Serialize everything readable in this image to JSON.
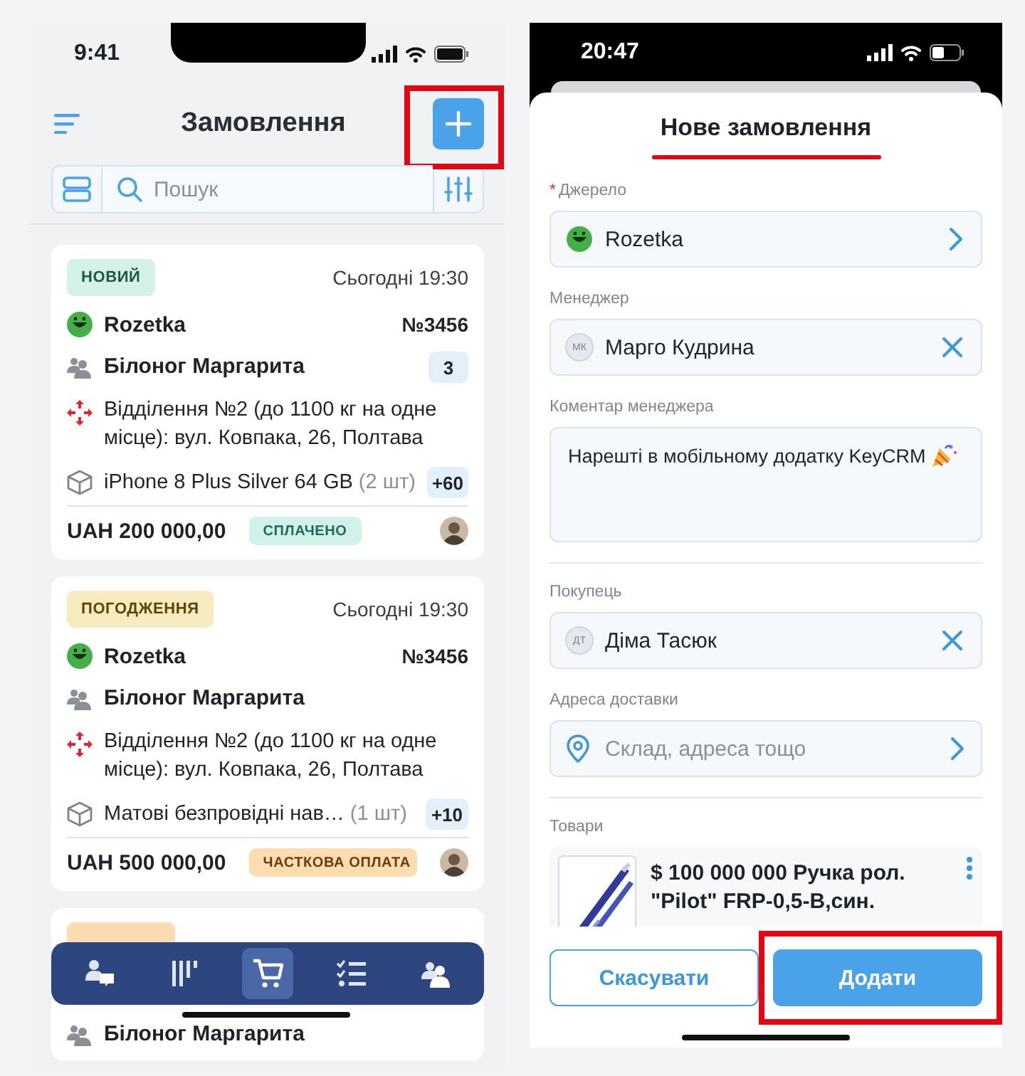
{
  "left": {
    "status_bar": {
      "time": "9:41"
    },
    "header": {
      "title": "Замовлення",
      "add_button": {
        "highlighted": true
      }
    },
    "search": {
      "placeholder": "Пошук"
    },
    "orders": [
      {
        "status": {
          "kind": "new",
          "label": "НОВИЙ"
        },
        "date": "Сьогодні 19:30",
        "source": "Rozetka",
        "number": "№3456",
        "customer": "Білоног Маргарита",
        "customer_count": "3",
        "address": "Відділення №2 (до 1100 кг на одне місце): вул. Ковпака, 26, Полтава",
        "product": "iPhone 8 Plus Silver 64 GB",
        "quantity": "(2 шт)",
        "extra": "+60",
        "total": "UAH 200 000,00",
        "payment": {
          "kind": "paid",
          "label": "СПЛАЧЕНО"
        }
      },
      {
        "status": {
          "kind": "approval",
          "label": "ПОГОДЖЕННЯ"
        },
        "date": "Сьогодні 19:30",
        "source": "Rozetka",
        "number": "№3456",
        "customer": "Білоног Маргарита",
        "address": "Відділення №2 (до 1100 кг на одне місце): вул. Ковпака, 26, Полтава",
        "product": "Матові безпровідні нав…",
        "quantity": "(1 шт)",
        "extra": "+10",
        "total": "UAH 500 000,00",
        "payment": {
          "kind": "partial",
          "label": "ЧАСТКОВА ОПЛАТА"
        }
      },
      {
        "status": {
          "kind": "partial"
        },
        "customer": "Білоног Маргарита"
      }
    ],
    "nav": [
      {
        "kind": "chat",
        "selected": false
      },
      {
        "kind": "board",
        "selected": false
      },
      {
        "kind": "cart",
        "selected": true
      },
      {
        "kind": "tasks",
        "selected": false
      },
      {
        "kind": "contacts",
        "selected": false
      }
    ]
  },
  "right": {
    "status_bar": {
      "time": "20:47"
    },
    "title": "Нове замовлення",
    "title_underlined": true,
    "sections": [
      {
        "fields": [
          {
            "kind": "source",
            "marker": "*",
            "label": "Джерело",
            "value": "Rozetka"
          },
          {
            "kind": "person",
            "label": "Менеджер",
            "initials": "МК",
            "value": "Марго Кудрина"
          },
          {
            "kind": "comment",
            "label": "Коментар менеджера",
            "value": "Нарешті в мобільному додатку KeyCRM"
          }
        ]
      },
      {
        "fields": [
          {
            "kind": "person",
            "label": "Покупець",
            "initials": "ДТ",
            "value": "Діма Тасюк"
          },
          {
            "kind": "address",
            "label": "Адреса доставки",
            "placeholder": "Склад, адреса тощо"
          }
        ]
      },
      {
        "fields": [
          {
            "kind": "products",
            "label": "Товари",
            "items": [
              {
                "name": "$ 100 000 000 Ручка рол. \"Pilot\" FRP-0,5-В,син."
              }
            ]
          }
        ]
      }
    ],
    "buttons": [
      {
        "kind": "cancel",
        "label": "Скасувати",
        "highlighted": false
      },
      {
        "kind": "submit",
        "label": "Додати",
        "highlighted": true
      }
    ]
  }
}
